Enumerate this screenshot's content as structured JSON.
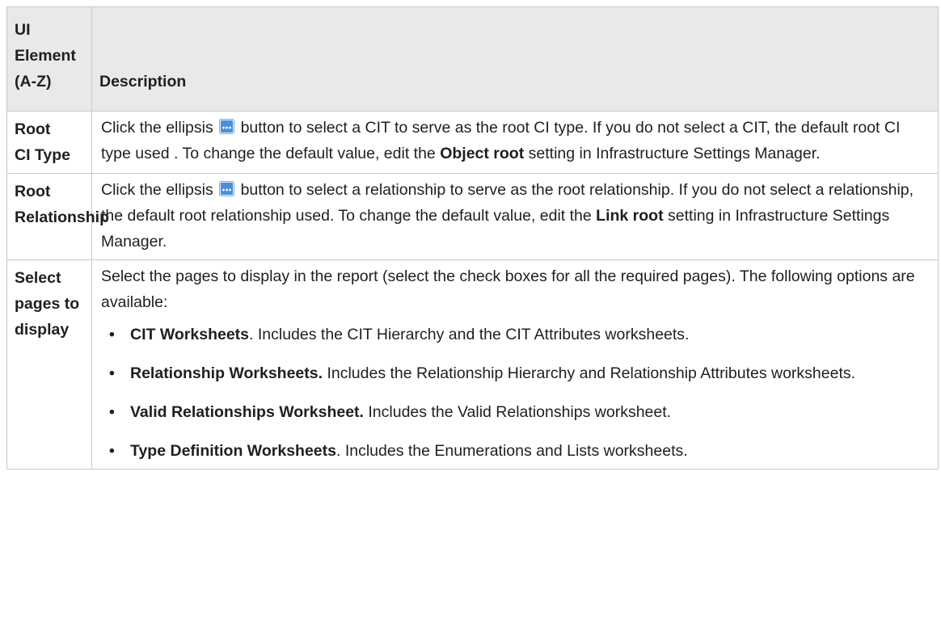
{
  "table": {
    "headers": {
      "ui_element": "UI Element (A-Z)",
      "description": "Description"
    },
    "rows": [
      {
        "name_lines": [
          "Root",
          "CI Type"
        ],
        "desc_before_icon": "Click the ellipsis",
        "desc_after_icon": "button to select a CIT to serve as the root CI type. If you do not select a CIT, the default root CI type used . To change the default value, edit the",
        "setting_name": "Object root",
        "desc_end": "setting in Infrastructure Settings Manager."
      },
      {
        "name_lines": [
          "Root",
          "Relationship"
        ],
        "desc_before_icon": "Click the ellipsis",
        "desc_after_icon": "button to select a relationship to serve as the root relationship. If you do not select a relationship, the default root relationship used. To change the default value, edit the",
        "setting_name": "Link root",
        "desc_end": "setting in Infrastructure Settings Manager."
      },
      {
        "name_lines": [
          "Select",
          "pages to",
          "display"
        ],
        "intro": "Select the pages to display in the report (select the check boxes for all the required pages). The following options are available:",
        "options": [
          {
            "title": "CIT Worksheets",
            "sep": ".",
            "text": " Includes the CIT Hierarchy and the CIT Attributes worksheets."
          },
          {
            "title": "Relationship Worksheets.",
            "sep": "",
            "text": " Includes the Relationship Hierarchy and Relationship Attributes worksheets."
          },
          {
            "title": "Valid Relationships Worksheet.",
            "sep": "",
            "text": " Includes the Valid Relationships worksheet."
          },
          {
            "title": "Type Definition Worksheets",
            "sep": ".",
            "text": " Includes the Enumerations and Lists worksheets."
          }
        ]
      }
    ]
  },
  "icons": {
    "ellipsis_button": "ellipsis-button-icon",
    "bullet": "•"
  },
  "colors": {
    "header_bg": "#e9e9e9",
    "border": "#c8c8c8",
    "ellipsis_icon": "#4a90d9"
  }
}
